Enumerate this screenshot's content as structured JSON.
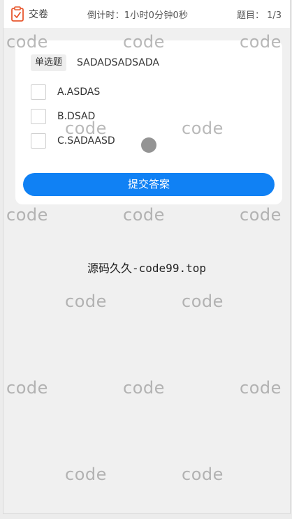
{
  "header": {
    "submit_label": "交卷",
    "countdown": "倒计时：1小时0分钟0秒",
    "progress": "题目： 1/3"
  },
  "question": {
    "type": "单选题",
    "text": "SADADSADSADA",
    "options": [
      {
        "label": "A.ASDAS"
      },
      {
        "label": "B.DSAD"
      },
      {
        "label": "C.SADAASD"
      }
    ],
    "submit_label": "提交答案"
  },
  "footer": {
    "source_text": "源码久久-code99.top"
  },
  "watermark": {
    "text": "code"
  },
  "colors": {
    "accent": "#1081f4",
    "icon": "#e8582f"
  },
  "icons": {
    "submit": "clipboard-icon"
  }
}
